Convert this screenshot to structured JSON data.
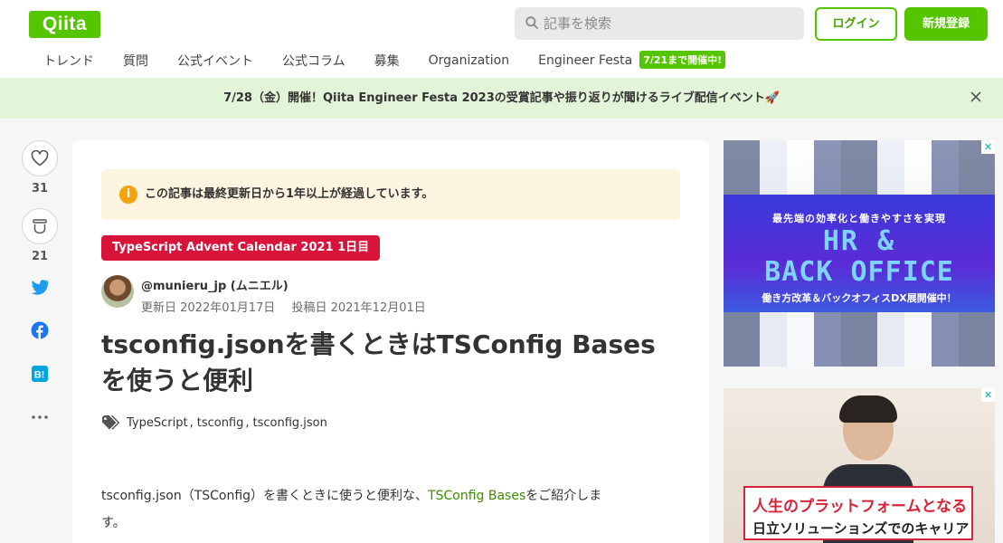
{
  "header": {
    "logo": "Qiita",
    "search_placeholder": "記事を検索",
    "login_label": "ログイン",
    "signup_label": "新規登録",
    "brand_color": "#55c500"
  },
  "nav": {
    "items": [
      "トレンド",
      "質問",
      "公式イベント",
      "公式コラム",
      "募集",
      "Organization",
      "Engineer Festa"
    ],
    "badge": "7/21まで開催中!"
  },
  "banner": {
    "text": "7/28（金）開催！Qiita Engineer Festa 2023の受賞記事や振り返りが聞けるライブ配信イベント🚀",
    "background": "#e3f5d8"
  },
  "sidebar": {
    "like_count": "31",
    "stock_count": "21",
    "icons": [
      "heart-icon",
      "stock-icon",
      "twitter-icon",
      "facebook-icon",
      "hatena-bookmark-icon",
      "more-icon"
    ]
  },
  "article": {
    "notice": "この記事は最終更新日から1年以上が経過しています。",
    "advent_badge": "TypeScript Advent Calendar 2021 1日目",
    "author": "@munieru_jp (ムニエル)",
    "updated": "更新日 2022年01月17日",
    "posted": "投稿日 2021年12月01日",
    "title_line1": "tsconfig.jsonを書くときはTSConfig Bases",
    "title_line2": "を使うと便利",
    "tags": [
      "TypeScript",
      "tsconfig",
      "tsconfig.json"
    ],
    "tag_separator": ",",
    "body_before": "tsconfig.json（TSConfig）を書くときに使うと便利な、",
    "body_link": "TSConfig Bases",
    "body_after": "をご紹介しま",
    "body_line2": "す。"
  },
  "ads": {
    "ad1": {
      "subtitle": "最先端の効率化と働きやすさを実現",
      "headline1": "HR &",
      "headline2": "BACK OFFICE",
      "footer": "働き方改革＆バックオフィスDX展開催中！"
    },
    "ad2": {
      "line1": "人生のプラットフォームとなる",
      "line2": "日立ソリューションズでのキャリア"
    },
    "ad_marker": "✕"
  }
}
